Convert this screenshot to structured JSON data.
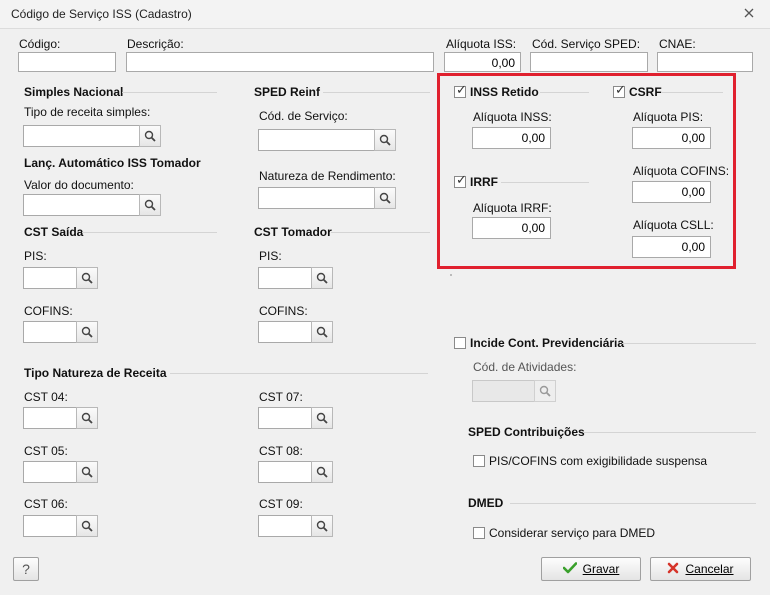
{
  "window": {
    "title": "Código de Serviço ISS (Cadastro)"
  },
  "top": {
    "codigo_label": "Código:",
    "descricao_label": "Descrição:",
    "aliquota_iss_label": "Alíquota ISS:",
    "aliquota_iss_value": "0,00",
    "cod_servico_sped_label": "Cód. Serviço SPED:",
    "cnae_label": "CNAE:"
  },
  "simples": {
    "header": "Simples Nacional",
    "tipo_receita_label": "Tipo de receita simples:"
  },
  "lanc_iss": {
    "header": "Lanç. Automático ISS Tomador",
    "valor_documento_label": "Valor do documento:"
  },
  "sped_reinf": {
    "header": "SPED Reinf",
    "cod_servico_label": "Cód. de Serviço:",
    "natureza_label": "Natureza de Rendimento:"
  },
  "cst_saida": {
    "header": "CST Saída",
    "pis_label": "PIS:",
    "cofins_label": "COFINS:"
  },
  "cst_tomador": {
    "header": "CST Tomador",
    "pis_label": "PIS:",
    "cofins_label": "COFINS:"
  },
  "tipo_natureza": {
    "header": "Tipo Natureza de Receita",
    "cst04": "CST 04:",
    "cst05": "CST 05:",
    "cst06": "CST 06:",
    "cst07": "CST 07:",
    "cst08": "CST 08:",
    "cst09": "CST 09:"
  },
  "retencoes": {
    "inss_retido_label": "INSS Retido",
    "aliquota_inss_label": "Alíquota INSS:",
    "aliquota_inss_value": "0,00",
    "irrf_label": "IRRF",
    "aliquota_irrf_label": "Alíquota IRRF:",
    "aliquota_irrf_value": "0,00",
    "csrf_label": "CSRF",
    "aliquota_pis_label": "Alíquota PIS:",
    "aliquota_pis_value": "0,00",
    "aliquota_cofins_label": "Alíquota COFINS:",
    "aliquota_cofins_value": "0,00",
    "aliquota_csll_label": "Alíquota CSLL:",
    "aliquota_csll_value": "0,00",
    "inss_checked": true,
    "irrf_checked": true,
    "csrf_checked": true
  },
  "previdenciaria": {
    "label": "Incide Cont. Previdenciária",
    "cod_atividades_label": "Cód. de Atividades:",
    "checked": false
  },
  "sped_contribuicoes": {
    "header": "SPED Contribuições",
    "checkbox_label": "PIS/COFINS com exigibilidade suspensa",
    "checked": false
  },
  "dmed": {
    "header": "DMED",
    "checkbox_label": "Considerar serviço para DMED",
    "checked": false
  },
  "footer": {
    "help_label": "?",
    "gravar_label": "Gravar",
    "cancelar_label": "Cancelar"
  },
  "colors": {
    "highlight_border": "#e0202e",
    "save_icon": "#3aa02c",
    "cancel_icon": "#d6342a"
  }
}
